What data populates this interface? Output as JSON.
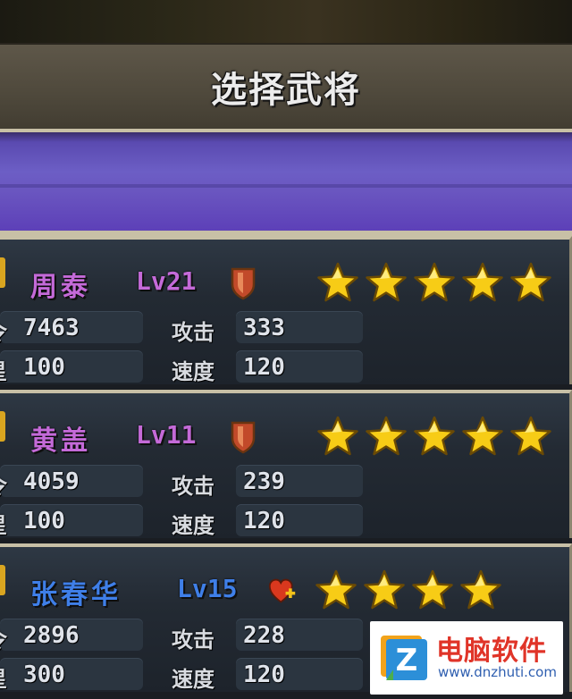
{
  "header": {
    "title": "选择武将"
  },
  "generals": [
    {
      "name": "周泰",
      "name_color": "#c46ad8",
      "level": "Lv21",
      "level_color": "#c46ad8",
      "badge_icon": "shield-icon",
      "stars": 5,
      "hp_label": "令",
      "hp": "7463",
      "attack_label": "攻击",
      "attack": "333",
      "cost_label": "星",
      "cost": "100",
      "speed_label": "速度",
      "speed": "120"
    },
    {
      "name": "黄盖",
      "name_color": "#c46ad8",
      "level": "Lv11",
      "level_color": "#c46ad8",
      "badge_icon": "shield-icon",
      "stars": 5,
      "hp_label": "令",
      "hp": "4059",
      "attack_label": "攻击",
      "attack": "239",
      "cost_label": "星",
      "cost": "100",
      "speed_label": "速度",
      "speed": "120"
    },
    {
      "name": "张春华",
      "name_color": "#3f7fe8",
      "level": "Lv15",
      "level_color": "#3f7fe8",
      "badge_icon": "heart-plus-icon",
      "stars": 4,
      "hp_label": "令",
      "hp": "2896",
      "attack_label": "攻击",
      "attack": "228",
      "cost_label": "星",
      "cost": "300",
      "speed_label": "速度",
      "speed": "120"
    }
  ],
  "watermark": {
    "brand": "电脑软件",
    "url": "www.dnzhuti.com",
    "logo_icon": "z-logo-icon"
  }
}
